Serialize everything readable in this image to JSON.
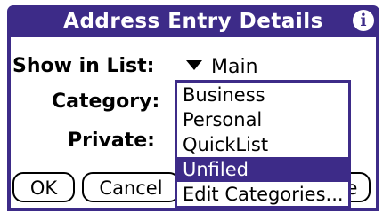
{
  "dialog": {
    "title": "Address Entry Details",
    "info_icon": "info-icon",
    "info_glyph": "i"
  },
  "fields": {
    "show_in_list_label": "Show in List:",
    "show_in_list_value": "Main",
    "category_label": "Category:",
    "private_label": "Private:"
  },
  "buttons": {
    "ok": "OK",
    "cancel": "Cancel",
    "partial": "e"
  },
  "popup": {
    "items": [
      "Business",
      "Personal",
      "QuickList",
      "Unfiled",
      "Edit Categories..."
    ],
    "selected": "Unfiled"
  },
  "colors": {
    "accent": "#3d2b88"
  }
}
